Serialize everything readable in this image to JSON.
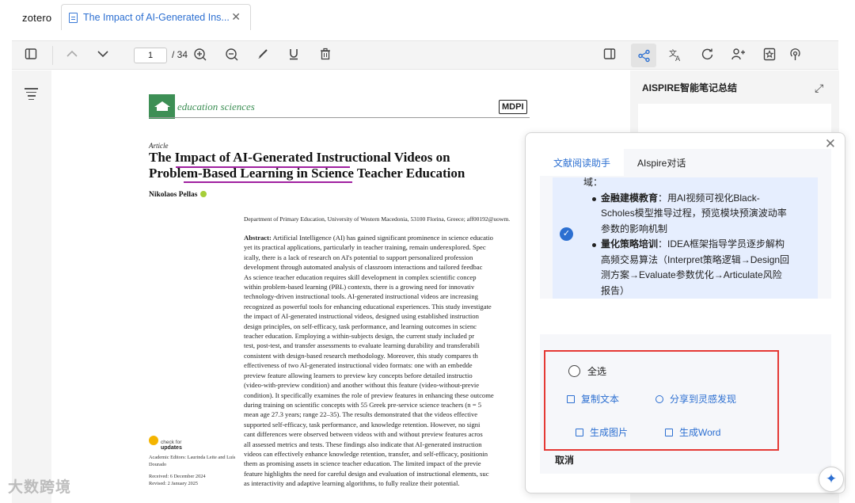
{
  "app": {
    "brand": "zotero",
    "tab_title": "The Impact of AI-Generated Ins..."
  },
  "toolbar": {
    "page_current": "1",
    "page_total": "/ 34"
  },
  "pdf": {
    "journal": "education sciences",
    "publisher": "MDPI",
    "kind": "Article",
    "title_line1": "The Impact of AI-Generated Instructional Videos on",
    "title_line2": "Problem-Based Learning in Science Teacher Education",
    "author": "Nikolaos Pellas",
    "affiliation": "Department of Primary Education, University of Western Macedonia, 53100 Florina, Greece; aff00192@uowm.",
    "abstract_label": "Abstract:",
    "abstract_lines": [
      " Artificial Intelligence (AI) has gained significant prominence in science educatio",
      "yet its practical applications, particularly in teacher training, remain underexplored. Spec",
      "ically, there is a lack of research on AI's potential to support personalized profession",
      "development through automated analysis of classroom interactions and tailored feedbac",
      "As science teacher education requires skill development in complex scientific concep",
      "within problem-based learning (PBL) contexts, there is a growing need for innovativ",
      "technology-driven instructional tools. AI-generated instructional videos are increasing",
      "recognized as powerful tools for enhancing educational experiences. This study investigate",
      "the impact of AI-generated instructional videos, designed using established instruction",
      "design principles, on self-efficacy, task performance, and learning outcomes in scienc",
      "teacher education. Employing a within-subjects design, the current study included pr",
      "test, post-test, and transfer assessments to evaluate learning durability and transferabili",
      "consistent with design-based research methodology. Moreover, this study compares th",
      "effectiveness of two AI-generated instructional video formats: one with an embedde",
      "preview feature allowing learners to preview key concepts before detailed instructio",
      "(video-with-preview condition) and another without this feature (video-without-previe",
      "condition). It specifically examines the role of preview features in enhancing these outcome",
      "during training on scientific concepts with 55 Greek pre-service science teachers (n = 5",
      "mean age 27.3 years; range 22–35). The results demonstrated that the videos effective",
      "supported self-efficacy, task performance, and knowledge retention. However, no signi",
      "cant differences were observed between videos with and without preview features acros",
      "all assessed metrics and tests. These findings also indicate that AI-generated instruction",
      "videos can effectively enhance knowledge retention, transfer, and self-efficacy, positionin",
      "them as promising assets in science teacher education. The limited impact of the previe",
      "feature highlights the need for careful design and evaluation of instructional elements, suc",
      "as interactivity and adaptive learning algorithms, to fully realize their potential."
    ],
    "check_updates": "check for",
    "check_updates_bold": "updates",
    "editors": "Academic Editors: Laurinda Leite and Luís Dourado",
    "received": "Received: 6 December 2024",
    "revised": "Revised: 2 January 2025"
  },
  "right_panel": {
    "title": "AISPIRE智能笔记总结"
  },
  "popup": {
    "tab_active": "文献阅读助手",
    "tab_inactive": "AIspire对话",
    "msg_head": "域：",
    "bullets": [
      {
        "bold": "金融建模教育",
        "text": "：用AI视频可视化Black-Scholes模型推导过程，预览模块预演波动率参数的影响机制"
      },
      {
        "bold": "量化策略培训",
        "text": "：IDEA框架指导学员逐步解构高频交易算法（Interpret策略逻辑→Design回测方案→Evaluate参数优化→Articulate风险报告）"
      }
    ],
    "select_all": "全选",
    "copy_text": "复制文本",
    "share": "分享到灵感发现",
    "gen_image": "生成图片",
    "gen_word": "生成Word",
    "cancel": "取消"
  },
  "watermark": "大数跨境",
  "icons": {
    "sidebar": "sidebar-toggle-icon",
    "up": "chevron-up-icon",
    "down": "chevron-down-icon",
    "zoom_in": "zoom-in-icon",
    "zoom_out": "zoom-out-icon",
    "highlight": "pen-icon",
    "underline": "underline-icon",
    "trash": "trash-icon",
    "share": "share-nodes-icon",
    "translate": "translate-icon",
    "settings": "refresh-icon",
    "add_user": "add-user-icon",
    "star": "star-doc-icon",
    "podcast": "podcast-icon"
  },
  "colors": {
    "accent": "#2c6fd1",
    "journal_green": "#3d8f55",
    "highlight_box": "#e53935",
    "underline": "#a020a0"
  }
}
